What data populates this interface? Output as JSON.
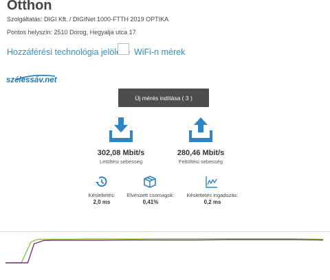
{
  "page": {
    "title": "Otthon",
    "service_line": "Szolgáltatás: DIGI Kft. / DIGINet 1000-FTTH 2019 OPTIKA",
    "location_line": "Pontos helyszín: 2510 Dorog, Hegyalja utca 17"
  },
  "links": {
    "tech_label": "Hozzáférési technológia jelölése",
    "wifi_label": "WiFi-n mérek"
  },
  "logo": {
    "text": "szélessáv.net"
  },
  "measure": {
    "start_label": "Új mérés indítása ( 3 )"
  },
  "results": {
    "download": {
      "value": "302,08 Mbit/s",
      "label": "Letöltési sebesség"
    },
    "upload": {
      "value": "280,46 Mbit/s",
      "label": "Feltöltési sebesség"
    },
    "latency": {
      "label": "Késleltetés:",
      "value": "2,0 ms"
    },
    "packet_loss": {
      "label": "Elveszett csomagok:",
      "value": "0,41%"
    },
    "jitter": {
      "label": "Késleltetés ingadozás:",
      "value": "0,2 ms"
    }
  },
  "colors": {
    "accent": "#2f8fd3",
    "icon_blue": "#2a86c8",
    "button_bg": "#4d4d4d",
    "download_line": "#8dc63f",
    "upload_line": "#7b2d8e"
  },
  "chart_data": {
    "type": "line",
    "grid": false,
    "series": [
      {
        "color": "#8dc63f",
        "x": [
          0,
          5,
          8,
          10,
          15,
          20,
          25,
          30,
          40,
          50,
          60,
          70,
          80,
          90,
          100
        ],
        "y": [
          0,
          0,
          82,
          92,
          93,
          93,
          94,
          94,
          94,
          95,
          95,
          95,
          95,
          95,
          93
        ]
      },
      {
        "color": "#7b2d8e",
        "x": [
          0,
          5,
          7,
          9,
          12,
          15,
          20,
          30,
          40,
          50,
          60,
          70,
          80,
          90,
          100
        ],
        "y": [
          0,
          0,
          0,
          75,
          88,
          89,
          89,
          89,
          90,
          90,
          90,
          91,
          91,
          91,
          90
        ]
      }
    ]
  }
}
